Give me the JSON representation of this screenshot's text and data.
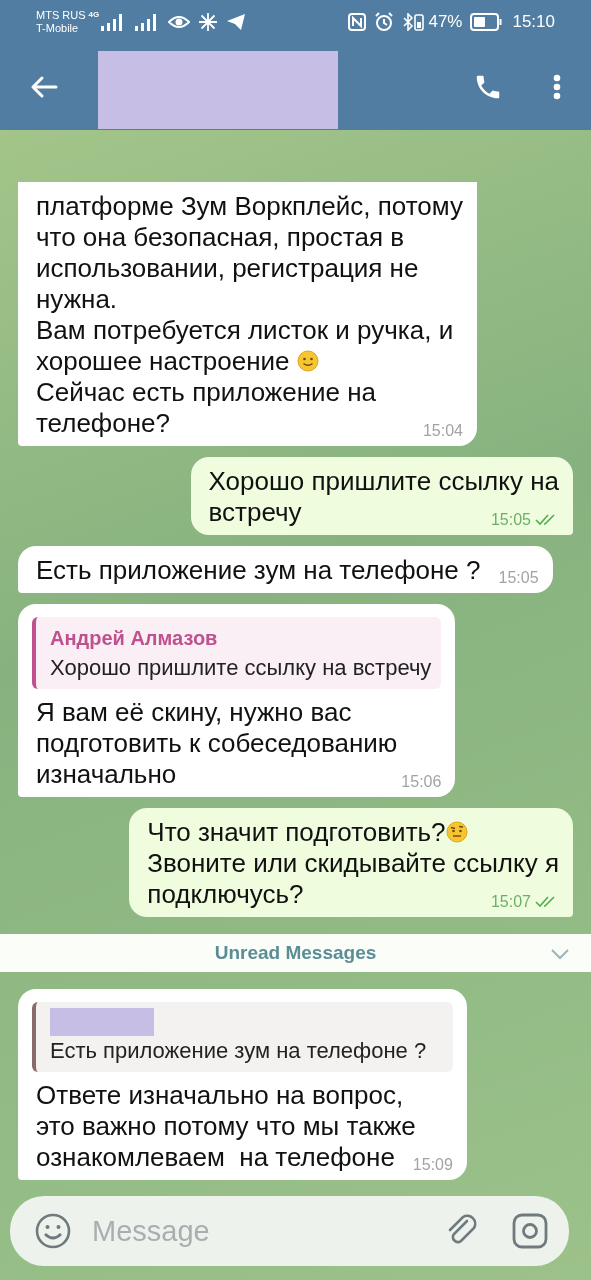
{
  "status_bar": {
    "carrier_1": "MTS RUS",
    "carrier_2": "T-Mobile",
    "network": "4G",
    "battery_percent": "47%",
    "time": "15:10"
  },
  "messages": [
    {
      "kind": "incoming",
      "top_cut": true,
      "body": [
        {
          "kind": "text",
          "text": "платформе Зум Воркплейс, потому\nчто она безопасная, простая в\nиспользовании, регистрация не\nнужна.\nВам потребуется листок и ручка, и\nхорошее настроение "
        },
        {
          "kind": "smile-emoji"
        },
        {
          "kind": "text",
          "text": "\nСейчас есть приложение на\nтелефоне?"
        }
      ],
      "time": "15:04"
    },
    {
      "kind": "outgoing",
      "body": [
        {
          "kind": "text",
          "text": "Хорошо пришлите ссылку на\nвстречу"
        }
      ],
      "time": "15:05",
      "read": true
    },
    {
      "kind": "incoming",
      "body": [
        {
          "kind": "text",
          "text": "Есть приложение зум на телефоне ?"
        }
      ],
      "time": "15:05"
    },
    {
      "kind": "incoming",
      "reply": {
        "author": "Андрей Алмазов",
        "text": "Хорошо пришлите ссылку на встречу",
        "color": "#c0508f"
      },
      "body": [
        {
          "kind": "text",
          "text": "Я вам её скину, нужно вас\nподготовить к собеседованию\nизначально"
        }
      ],
      "time": "15:06"
    },
    {
      "kind": "outgoing",
      "body": [
        {
          "kind": "text",
          "text": "Что значит подготовить?"
        },
        {
          "kind": "skeptical-emoji"
        },
        {
          "kind": "text",
          "text": "\nЗвоните или скидывайте ссылку я\nподключусь?"
        }
      ],
      "time": "15:07",
      "read": true
    },
    {
      "kind": "divider",
      "text": "Unread Messages"
    },
    {
      "kind": "incoming",
      "reply": {
        "author_redacted": true,
        "text": "Есть приложение зум на телефоне ?",
        "color": "#8a6a6a"
      },
      "body": [
        {
          "kind": "text",
          "text": "Ответе изначально на вопрос,\nэто важно потому что мы также\nознакомлеваем  на телефоне"
        }
      ],
      "time": "15:09"
    }
  ],
  "composer": {
    "placeholder": "Message"
  }
}
